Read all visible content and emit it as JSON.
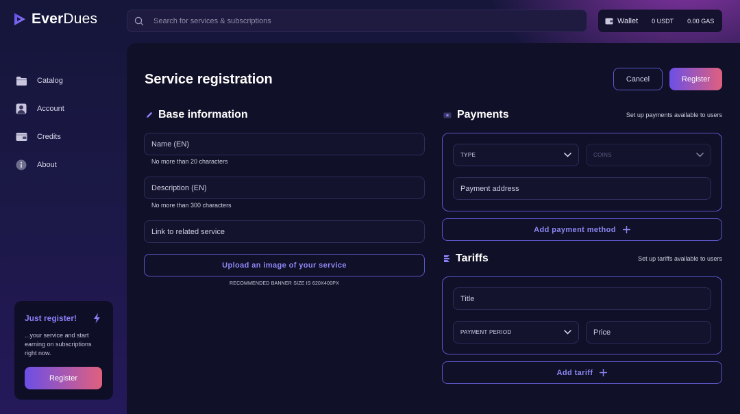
{
  "app": {
    "name_bold": "Ever",
    "name_light": "Dues",
    "accent": "#6b4fe6",
    "accent_end": "#e0607e"
  },
  "search": {
    "placeholder": "Search for services & subscriptions",
    "icon": "search-icon"
  },
  "wallet": {
    "label": "Wallet",
    "usdt": "0 USDT",
    "gas": "0.00 GAS"
  },
  "sidebar": {
    "items": [
      {
        "label": "Catalog",
        "icon": "folder-icon"
      },
      {
        "label": "Account",
        "icon": "user-icon"
      },
      {
        "label": "Credits",
        "icon": "wallet-icon"
      },
      {
        "label": "About",
        "icon": "info-icon"
      }
    ],
    "promo": {
      "title": "Just register!",
      "text": "...your service and start earning on subscriptions right now.",
      "button": "Register"
    }
  },
  "page": {
    "title": "Service registration",
    "cancel": "Cancel",
    "register": "Register"
  },
  "base_info": {
    "title": "Base information",
    "name_placeholder": "Name (EN)",
    "name_hint": "No more than 20 characters",
    "description_placeholder": "Description (EN)",
    "description_hint": "No more than 300 characters",
    "link_placeholder": "Link to related service",
    "upload_label": "Upload an image of your service",
    "upload_hint": "RECOMMENDED BANNER SIZE IS 620X400PX"
  },
  "payments": {
    "title": "Payments",
    "hint": "Set up payments available to users",
    "type_label": "TYPE",
    "coins_label": "COINS",
    "address_placeholder": "Payment address",
    "add_label": "Add payment method"
  },
  "tariffs": {
    "title": "Tariffs",
    "hint": "Set up tariffs available to users",
    "title_placeholder": "Title",
    "period_label": "PAYMENT PERIOD",
    "price_placeholder": "Price",
    "add_label": "Add tariff"
  }
}
